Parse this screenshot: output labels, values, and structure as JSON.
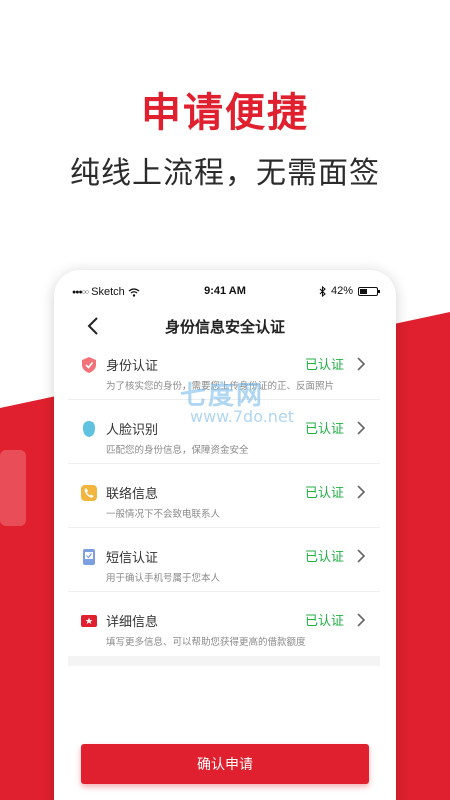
{
  "promo": {
    "headline": "申请便捷",
    "subheadline": "纯线上流程，无需面签"
  },
  "status_bar": {
    "carrier": "Sketch",
    "time": "9:41 AM",
    "battery_percent": "42%",
    "battery_level": 0.42
  },
  "nav": {
    "title": "身份信息安全认证"
  },
  "items": [
    {
      "title": "身份认证",
      "desc": "为了核实您的身份，需要您上传身份证的正、反面照片",
      "status": "已认证",
      "icon": "shield-icon",
      "icon_color": "#f2727a"
    },
    {
      "title": "人脸识别",
      "desc": "匹配您的身份信息，保障资金安全",
      "status": "已认证",
      "icon": "face-icon",
      "icon_color": "#5fc3df"
    },
    {
      "title": "联络信息",
      "desc": "一般情况下不会致电联系人",
      "status": "已认证",
      "icon": "phone-icon",
      "icon_color": "#f4b53f"
    },
    {
      "title": "短信认证",
      "desc": "用于确认手机号属于您本人",
      "status": "已认证",
      "icon": "sms-icon",
      "icon_color": "#7b9fe0"
    },
    {
      "title": "详细信息",
      "desc": "填写更多信息、可以帮助您获得更高的借款额度",
      "status": "已认证",
      "icon": "detail-icon",
      "icon_color": "#e0202e"
    }
  ],
  "confirm_button": "确认申请",
  "watermark": {
    "line1": "七度网",
    "line2": "www.7do.net"
  },
  "colors": {
    "brand_red": "#e0202e",
    "verified_green": "#1fae43"
  }
}
